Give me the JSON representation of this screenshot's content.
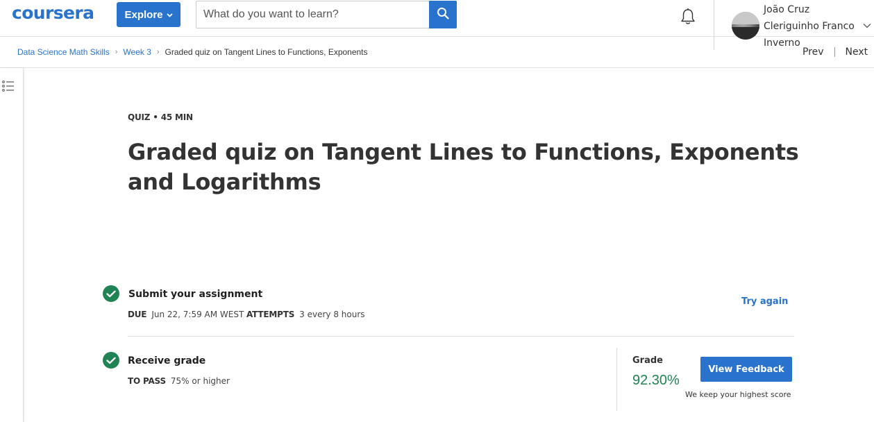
{
  "header": {
    "logo_text": "coursera",
    "explore_label": "Explore",
    "search_placeholder": "What do you want to learn?",
    "user_name": "João Cruz Cleriguinho Franco Inverno"
  },
  "breadcrumb": {
    "items": [
      "Data Science Math Skills",
      "Week 3"
    ],
    "current": "Graded quiz on Tangent Lines to Functions, Exponents"
  },
  "nav": {
    "prev": "Prev",
    "next": "Next"
  },
  "quiz": {
    "meta": "QUIZ • 45 MIN",
    "title": "Graded quiz on Tangent Lines to Functions, Exponents and Logarithms"
  },
  "submit": {
    "title": "Submit your assignment",
    "due_label": "DUE",
    "due_value": "Jun 22, 7:59 AM WEST",
    "attempts_label": "ATTEMPTS",
    "attempts_value": "3 every 8 hours",
    "try_again": "Try again"
  },
  "receive": {
    "title": "Receive grade",
    "to_pass_label": "TO PASS",
    "to_pass_value": "75% or higher"
  },
  "grade": {
    "label": "Grade",
    "value": "92.30%",
    "feedback_button": "View Feedback",
    "note": "We keep your highest score"
  },
  "colors": {
    "brand_blue": "#2a73cc",
    "success_green": "#1f8354"
  },
  "icons": [
    "search-icon",
    "bell-icon",
    "chevron-down-icon",
    "list-toggle-icon",
    "check-icon"
  ]
}
